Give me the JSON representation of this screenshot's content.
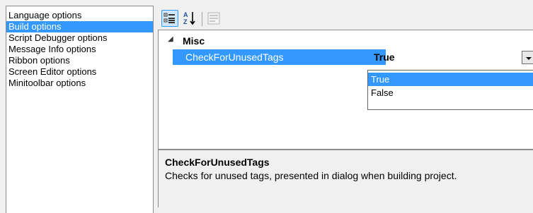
{
  "categories": {
    "items": [
      {
        "label": "Language options",
        "selected": false
      },
      {
        "label": "Build options",
        "selected": true
      },
      {
        "label": "Script Debugger options",
        "selected": false
      },
      {
        "label": "Message Info options",
        "selected": false
      },
      {
        "label": "Ribbon options",
        "selected": false
      },
      {
        "label": "Screen Editor options",
        "selected": false
      },
      {
        "label": "Minitoolbar options",
        "selected": false
      }
    ]
  },
  "toolbar": {
    "categorized_icon": "categorized-view-icon",
    "alphabetical_icon": "alphabetical-sort-icon",
    "property_pages_icon": "property-pages-icon"
  },
  "grid": {
    "category": "Misc",
    "property": {
      "name": "CheckForUnusedTags",
      "value": "True"
    },
    "dropdown_options": [
      "True",
      "False"
    ],
    "selected_option": "True"
  },
  "description": {
    "title": "CheckForUnusedTags",
    "text": "Checks for unused tags, presented in dialog when building project."
  },
  "colors": {
    "selection": "#3399ff",
    "background": "#f0f0f0",
    "panel": "#ffffff"
  }
}
